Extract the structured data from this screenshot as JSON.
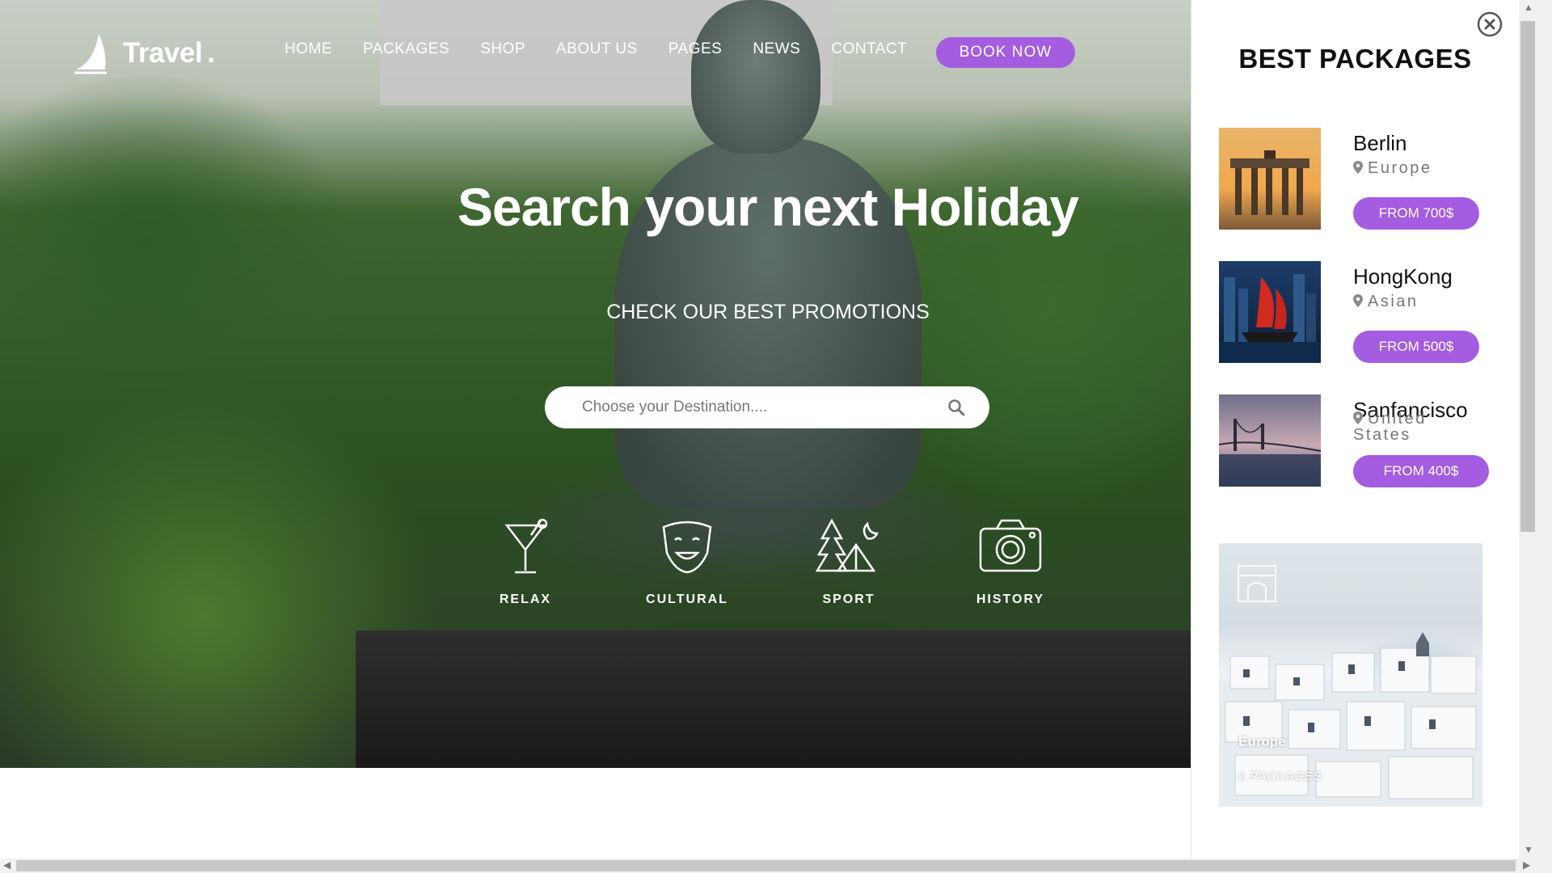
{
  "nav": {
    "logo_text": "Travel",
    "logo_dot": ".",
    "items": [
      "HOME",
      "PACKAGES",
      "SHOP",
      "ABOUT US",
      "PAGES",
      "NEWS",
      "CONTACT"
    ],
    "book_label": "BOOK NOW"
  },
  "hero": {
    "title": "Search your next Holiday",
    "subtitle": "CHECK OUR BEST PROMOTIONS",
    "search_placeholder": "Choose your Destination...."
  },
  "categories": [
    {
      "label": "RELAX",
      "icon": "cocktail-icon"
    },
    {
      "label": "CULTURAL",
      "icon": "theater-mask-icon"
    },
    {
      "label": "SPORT",
      "icon": "camping-icon"
    },
    {
      "label": "HISTORY",
      "icon": "camera-icon"
    }
  ],
  "sidebar": {
    "title": "BEST PACKAGES",
    "packages": [
      {
        "name": "Berlin",
        "region": "Europe",
        "price": "FROM 700$"
      },
      {
        "name": "HongKong",
        "region": "Asian",
        "price": "FROM 500$"
      },
      {
        "name": "Sanfancisco",
        "region": "United States",
        "price": "FROM 400$"
      }
    ],
    "promo": {
      "region": "Europe",
      "count": "2 PACKAGES"
    }
  },
  "colors": {
    "accent": "#a45ce0",
    "text_dark": "#111111",
    "text_muted": "#777777"
  }
}
